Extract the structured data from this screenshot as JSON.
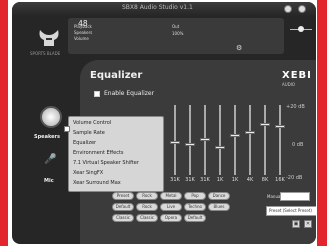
{
  "window": {
    "title": "SBX8 Audio Studio v1.1"
  },
  "logo": {
    "icon": "horned-helmet-logo",
    "sub_text": "SPORTS BLADE"
  },
  "top_panel": {
    "label1": "Playback",
    "label2": "Speakers",
    "label3": "Volume",
    "volume_value": "48",
    "label4": "Out",
    "label5": "100%"
  },
  "equalizer": {
    "title": "Equalizer",
    "brand": "XEBI",
    "brand_sub": "AUDIO",
    "enable_label": "Enable Equalizer",
    "db_labels": {
      "top": "+20 dB",
      "mid": "0 dB",
      "bottom": "-20 dB"
    },
    "bands": [
      {
        "freq": "31K",
        "level": 0.55
      },
      {
        "freq": "31K",
        "level": 0.58
      },
      {
        "freq": "31K",
        "level": 0.5
      },
      {
        "freq": "1K",
        "level": 0.62
      },
      {
        "freq": "1K",
        "level": 0.44
      },
      {
        "freq": "4K",
        "level": 0.4
      },
      {
        "freq": "8K",
        "level": 0.27
      },
      {
        "freq": "16K",
        "level": 0.3
      }
    ],
    "presets_row1": [
      "Preset",
      "Rock",
      "Metal",
      "Pop",
      "Dance"
    ],
    "presets_row2": [
      "Default",
      "Rock",
      "Live",
      "Techno",
      "Blues"
    ],
    "presets_row3": [
      "Classic",
      "Classic",
      "Opera",
      "Default"
    ],
    "manual_label": "Manual",
    "preset_select": "Preset (Select Preset)"
  },
  "side": {
    "speakers_label": "Speakers",
    "mic_label": "Mic"
  },
  "menu": {
    "items": [
      "Volume Control",
      "Sample Rate",
      "Equalizer",
      "Environment Effects",
      "7.1 Virtual Speaker Shifter",
      "Xear SingFX",
      "Xear Surround Max"
    ]
  },
  "colors": {
    "accent_red": "#e3262d",
    "panel_dark": "#262626",
    "panel": "#3b3b3b"
  }
}
